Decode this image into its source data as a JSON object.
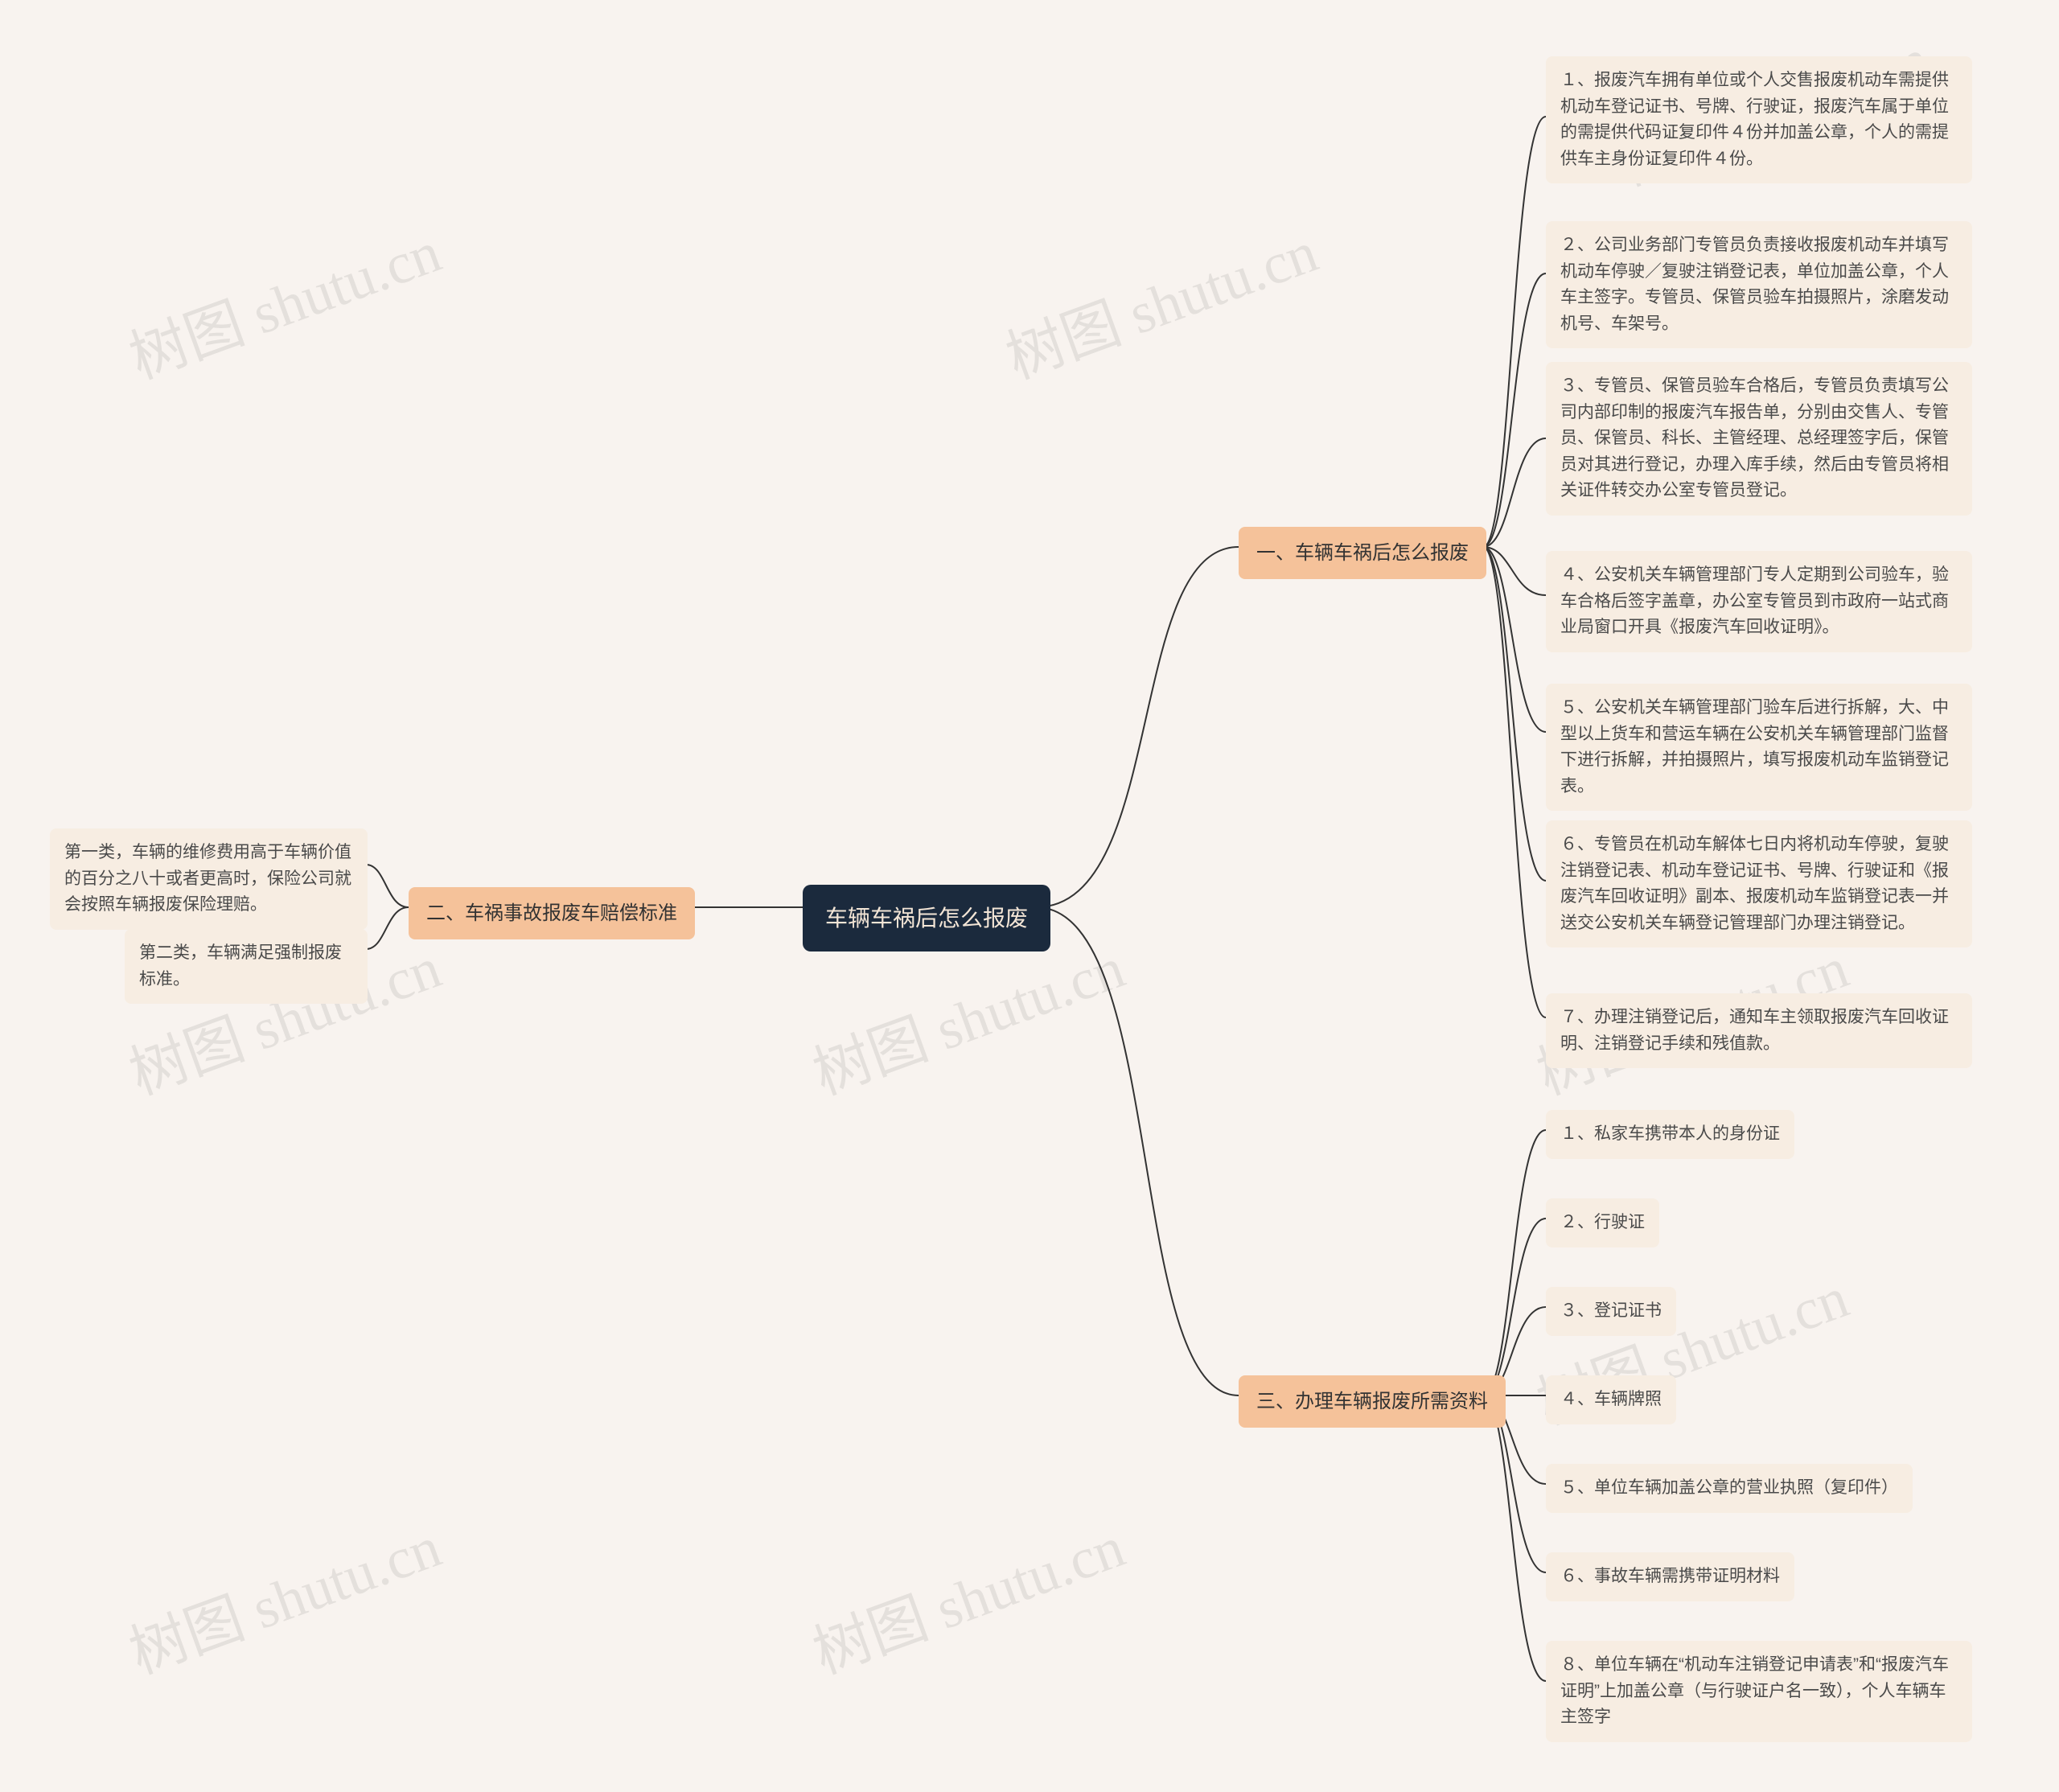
{
  "watermark": "树图 shutu.cn",
  "root": {
    "label": "车辆车祸后怎么报废"
  },
  "branch1": {
    "label": "一、车辆车祸后怎么报废",
    "leaves": [
      "１、报废汽车拥有单位或个人交售报废机动车需提供机动车登记证书、号牌、行驶证，报废汽车属于单位的需提供代码证复印件４份并加盖公章，个人的需提供车主身份证复印件４份。",
      "２、公司业务部门专管员负责接收报废机动车并填写机动车停驶／复驶注销登记表，单位加盖公章，个人车主签字。专管员、保管员验车拍摄照片，涂磨发动机号、车架号。",
      "３、专管员、保管员验车合格后，专管员负责填写公司内部印制的报废汽车报告单，分别由交售人、专管员、保管员、科长、主管经理、总经理签字后，保管员对其进行登记，办理入库手续，然后由专管员将相关证件转交办公室专管员登记。",
      "４、公安机关车辆管理部门专人定期到公司验车，验车合格后签字盖章，办公室专管员到市政府一站式商业局窗口开具《报废汽车回收证明》。",
      "５、公安机关车辆管理部门验车后进行拆解，大、中型以上货车和营运车辆在公安机关车辆管理部门监督下进行拆解，并拍摄照片，填写报废机动车监销登记表。",
      "６、专管员在机动车解体七日内将机动车停驶，复驶注销登记表、机动车登记证书、号牌、行驶证和《报废汽车回收证明》副本、报废机动车监销登记表一并送交公安机关车辆登记管理部门办理注销登记。",
      "７、办理注销登记后，通知车主领取报废汽车回收证明、注销登记手续和残值款。"
    ]
  },
  "branch2": {
    "label": "二、车祸事故报废车赔偿标准",
    "leaves": [
      "第一类，车辆的维修费用高于车辆价值的百分之八十或者更高时，保险公司就会按照车辆报废保险理赔。",
      "第二类，车辆满足强制报废标准。"
    ]
  },
  "branch3": {
    "label": "三、办理车辆报废所需资料",
    "leaves": [
      "１、私家车携带本人的身份证",
      "２、行驶证",
      "３、登记证书",
      "４、车辆牌照",
      "５、单位车辆加盖公章的营业执照（复印件）",
      "６、事故车辆需携带证明材料",
      "８、单位车辆在“机动车注销登记申请表”和“报废汽车证明”上加盖公章（与行驶证户名一致），个人车辆车主签字"
    ]
  }
}
